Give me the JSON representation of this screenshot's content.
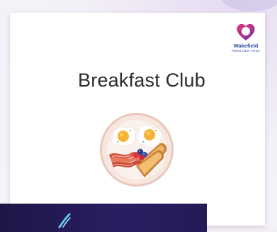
{
  "slide": {
    "title": "Breakfast Club",
    "image_icon": "breakfast-plate-icon"
  },
  "logo": {
    "icon": "heart-logo-icon",
    "name": "Wakefield",
    "subtitle": "Parent Carer Forum"
  },
  "colors": {
    "logo_text": "#2e4fa3",
    "logo_gradient_start": "#e0347a",
    "logo_gradient_end": "#5a2ea6",
    "panel": "#231a55",
    "plate_rim": "#f3dfd5"
  }
}
